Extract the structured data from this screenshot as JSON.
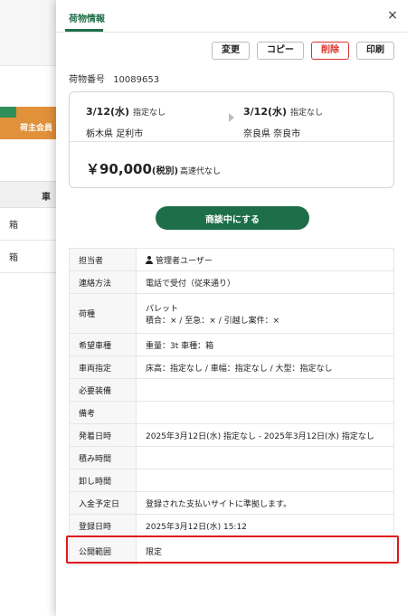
{
  "background": {
    "banner_text": "荷主会員",
    "table_header": "車",
    "rows": [
      "箱",
      "箱"
    ]
  },
  "drawer": {
    "tab_label": "荷物情報",
    "close_glyph": "×",
    "actions": {
      "change": "変更",
      "copy": "コピー",
      "delete": "削除",
      "print": "印刷"
    },
    "cargo_number_label": "荷物番号",
    "cargo_number": "10089653",
    "route": {
      "from": {
        "date": "3/12(水)",
        "note": "指定なし",
        "place": "栃木県 足利市"
      },
      "to": {
        "date": "3/12(水)",
        "note": "指定なし",
        "place": "奈良県 奈良市"
      }
    },
    "price": {
      "amount": "￥90,000",
      "tax": "(税別)",
      "toll": "高速代なし"
    },
    "negotiate_button": "商談中にする",
    "details": {
      "person_label": "担当者",
      "person_value": "管理者ユーザー",
      "contact_label": "連絡方法",
      "contact_value": "電話で受付（従来通り）",
      "cargo_label": "荷種",
      "cargo_value_1": "パレット",
      "cargo_value_2": "積合：× / 至急：× / 引越し案件：×",
      "vehicle_label": "希望車種",
      "vehicle_value": "重量：3t 車種：箱",
      "vehicle_spec_label": "車両指定",
      "vehicle_spec_value": "床高：指定なし / 車幅：指定なし / 大型：指定なし",
      "equipment_label": "必要装備",
      "equipment_value": "",
      "remarks_label": "備考",
      "remarks_value": "",
      "schedule_label": "発着日時",
      "schedule_value": "2025年3月12日(水) 指定なし - 2025年3月12日(水) 指定なし",
      "loading_label": "積み時間",
      "loading_value": "",
      "unloading_label": "卸し時間",
      "unloading_value": "",
      "payment_label": "入金予定日",
      "payment_value": "登録された支払いサイトに準拠します。",
      "registered_label": "登録日時",
      "registered_value": "2025年3月12日(水) 15:12",
      "scope_label": "公開範囲",
      "scope_value": "限定"
    }
  },
  "colors": {
    "accent": "#1f6e4a",
    "danger": "#d9322b",
    "highlight": "#e0191b"
  }
}
